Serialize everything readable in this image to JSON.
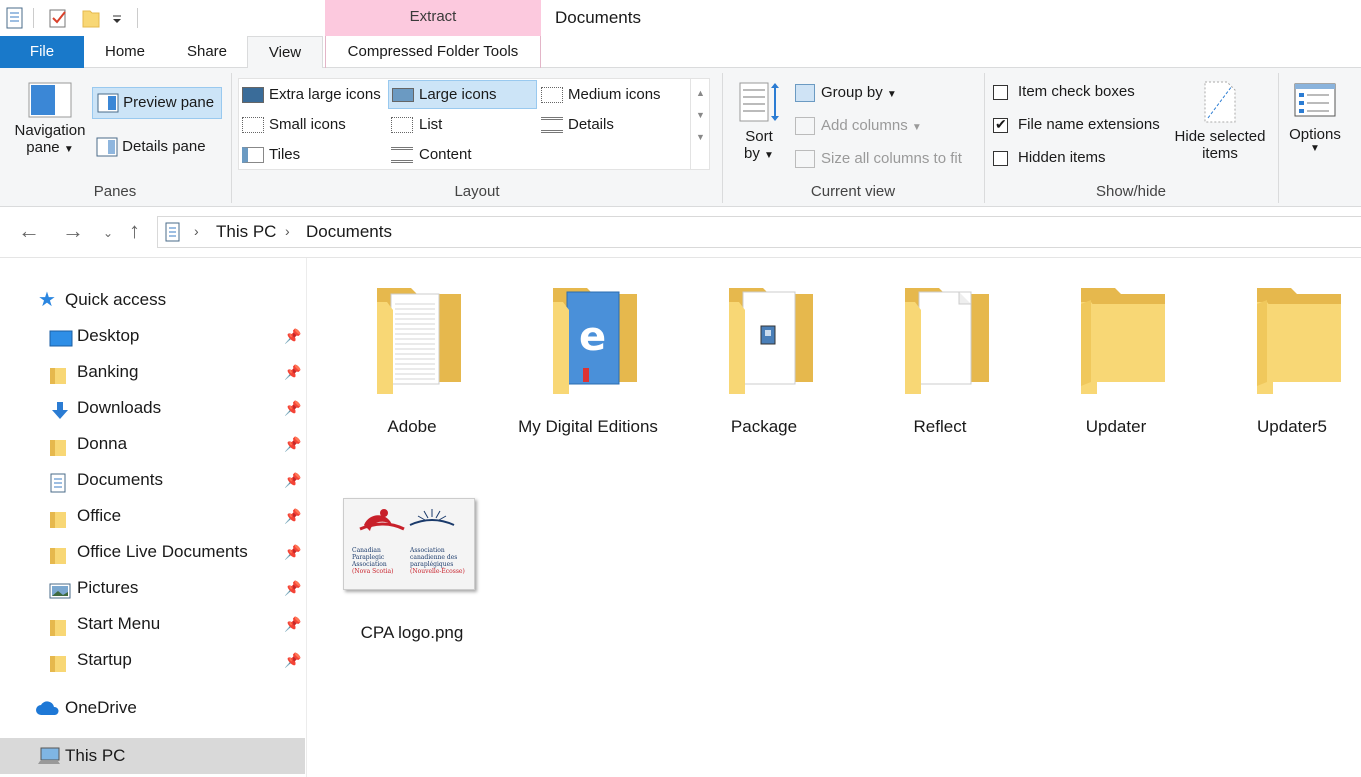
{
  "window": {
    "title": "Documents",
    "contextual_tab_group": "Extract"
  },
  "qat": {
    "icons": [
      "properties-icon",
      "checkmark-icon",
      "new-folder-icon",
      "customize-dropdown-icon"
    ]
  },
  "tabs": {
    "file": "File",
    "home": "Home",
    "share": "Share",
    "view": "View",
    "compressed": "Compressed Folder Tools"
  },
  "ribbon": {
    "panes": {
      "navigation_line1": "Navigation",
      "navigation_line2": "pane",
      "preview": "Preview pane",
      "details": "Details pane",
      "label": "Panes"
    },
    "layout": {
      "extra_large": "Extra large icons",
      "large": "Large icons",
      "medium": "Medium icons",
      "small": "Small icons",
      "list": "List",
      "details": "Details",
      "tiles": "Tiles",
      "content": "Content",
      "label": "Layout"
    },
    "current_view": {
      "sort_line1": "Sort",
      "sort_line2": "by",
      "group_by": "Group by",
      "add_columns": "Add columns",
      "size_columns": "Size all columns to fit",
      "label": "Current view"
    },
    "show_hide": {
      "item_checkboxes": "Item check boxes",
      "file_extensions": "File name extensions",
      "hidden_items": "Hidden items",
      "hide_selected_line1": "Hide selected",
      "hide_selected_line2": "items",
      "label": "Show/hide",
      "item_checkboxes_checked": false,
      "file_extensions_checked": true,
      "hidden_items_checked": false
    },
    "options": {
      "label": "Options"
    }
  },
  "address": {
    "crumbs": [
      "This PC",
      "Documents"
    ]
  },
  "sidebar": {
    "quick_access": "Quick access",
    "items": [
      {
        "label": "Desktop",
        "icon": "desktop-icon"
      },
      {
        "label": "Banking",
        "icon": "folder-icon"
      },
      {
        "label": "Downloads",
        "icon": "download-icon"
      },
      {
        "label": "Donna",
        "icon": "folder-icon"
      },
      {
        "label": "Documents",
        "icon": "documents-icon"
      },
      {
        "label": "Office",
        "icon": "folder-icon"
      },
      {
        "label": "Office Live Documents",
        "icon": "folder-icon"
      },
      {
        "label": "Pictures",
        "icon": "pictures-icon"
      },
      {
        "label": "Start Menu",
        "icon": "folder-icon"
      },
      {
        "label": "Startup",
        "icon": "folder-icon"
      }
    ],
    "onedrive": "OneDrive",
    "this_pc": "This PC"
  },
  "files": [
    {
      "name": "Adobe",
      "type": "folder-docs"
    },
    {
      "name": "My Digital Editions",
      "type": "folder-edge"
    },
    {
      "name": "Package",
      "type": "folder-installer"
    },
    {
      "name": "Reflect",
      "type": "folder-doc"
    },
    {
      "name": "Updater",
      "type": "folder"
    },
    {
      "name": "Updater5",
      "type": "folder"
    },
    {
      "name": "CPA logo.png",
      "type": "image"
    }
  ],
  "cpa_logo": {
    "en_line1": "Canadian",
    "en_line2": "Paraplegic",
    "en_line3": "Association",
    "en_line4": "(Nova Scotia)",
    "fr_line1": "Association",
    "fr_line2": "canadienne des",
    "fr_line3": "paraplégiques",
    "fr_line4": "(Nouvelle-Écosse)"
  },
  "colors": {
    "accent": "#1979ca",
    "folder": "#f8d775",
    "folder_dark": "#e6b84d",
    "selected": "#cce4f7",
    "context_tab": "#fcc9de"
  }
}
